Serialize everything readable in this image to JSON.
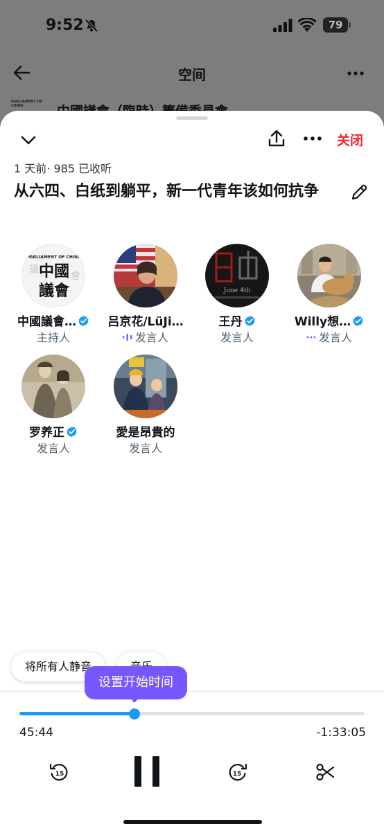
{
  "status": {
    "time": "9:52",
    "battery": "79"
  },
  "background": {
    "nav_title": "空间",
    "host_name": "中國議會（臨時）籌備委員會",
    "host_logo_text": "PARLIAMENT OF CHINA"
  },
  "sheet": {
    "close_label": "关闭",
    "meta": "1 天前· 985 已收听",
    "title": "从六四、白纸到躺平，新一代青年该如何抗争"
  },
  "speakers": [
    {
      "name": "中國議會…",
      "role": "主持人",
      "verified": true,
      "speaking": false,
      "logo_top": "PARLIAMENT OF CHINA",
      "logo_chars": "中國議會"
    },
    {
      "name": "吕京花/LüJi…",
      "role": "发言人",
      "verified": false,
      "speaking": true
    },
    {
      "name": "王丹",
      "role": "发言人",
      "verified": true,
      "speaking": false,
      "avatar_text": "June 4th"
    },
    {
      "name": "Willy想…",
      "role": "发言人",
      "verified": true,
      "speaking": true
    },
    {
      "name": "罗养正",
      "role": "发言人",
      "verified": true,
      "speaking": false
    },
    {
      "name": "愛是昂貴的",
      "role": "发言人",
      "verified": false,
      "speaking": false
    }
  ],
  "controls": {
    "mute_all_label": "将所有人静音",
    "music_label": "音乐",
    "tooltip": "设置开始时间",
    "elapsed": "45:44",
    "remaining": "-1:33:05",
    "progress_fraction": 0.334,
    "skip_seconds": "15"
  },
  "colors": {
    "accent": "#1d9bf0",
    "close": "#f4212e",
    "tooltip": "#7856ff"
  }
}
